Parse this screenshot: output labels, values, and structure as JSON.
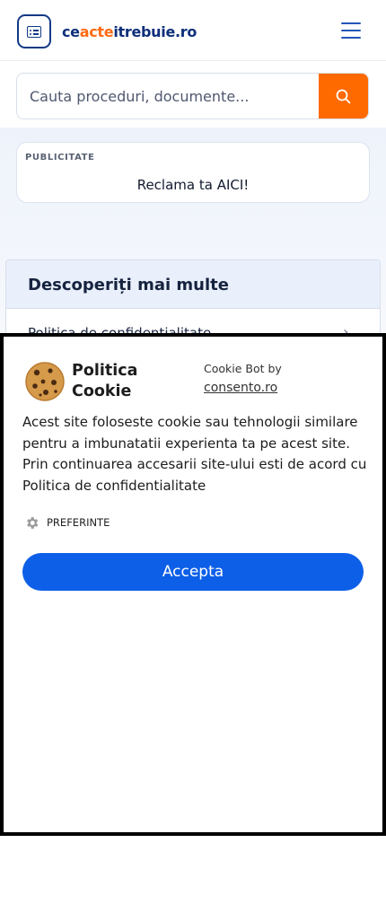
{
  "header": {
    "brand_prefix": "ce",
    "brand_accent": "acte",
    "brand_suffix": "itrebuie.ro",
    "logo_icon": "document-list-icon",
    "menu_icon": "hamburger-menu-icon"
  },
  "search": {
    "placeholder": "Cauta proceduri, documente...",
    "value": "",
    "button_icon": "search-icon"
  },
  "ad": {
    "label": "PUBLICITATE",
    "text": "Reclama ta AICI!"
  },
  "discover": {
    "title": "Descoperiți mai multe",
    "item": "Politica de confidentialitate",
    "chevron_icon": "chevron-right-icon"
  },
  "cookie": {
    "title_line1": "Politica",
    "title_line2": "Cookie",
    "by_label": "Cookie Bot by",
    "by_link": "consento.ro",
    "body": "Acest site foloseste cookie sau tehnologii similare pentru a imbunatatii experienta ta pe acest site. Prin continuarea accesarii site-ului esti de acord cu Politica de confidentialitate",
    "preferences_label": "PREFERINTE",
    "accept_label": "Accepta",
    "icon": "cookie-icon",
    "gear_icon": "gear-icon"
  },
  "colors": {
    "brand_blue": "#0d2f7a",
    "brand_orange": "#ff6a13",
    "search_button": "#ff6a00",
    "accept_button": "#0d5fe8"
  }
}
